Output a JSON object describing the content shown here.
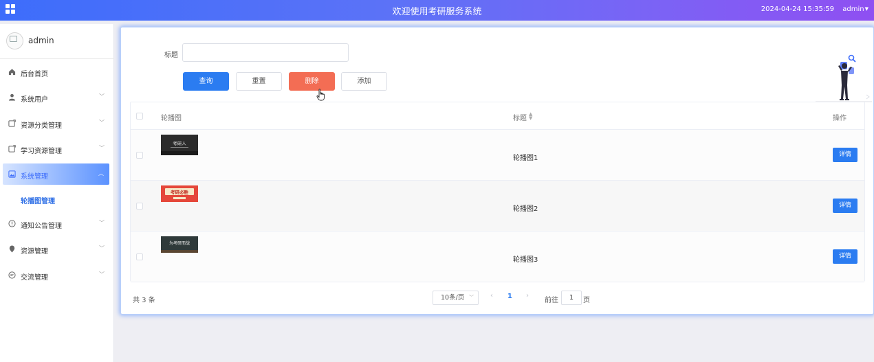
{
  "header": {
    "title": "欢迎使用考研服务系统",
    "datetime": "2024-04-24 15:35:59",
    "user": "admin",
    "apps_icon": "grid-icon"
  },
  "sidebar": {
    "username": "admin",
    "items": [
      {
        "label": "后台首页",
        "icon": "home-icon"
      },
      {
        "label": "系统用户",
        "icon": "user-icon",
        "has_arrow": true
      },
      {
        "label": "资源分类管理",
        "icon": "folder-icon",
        "has_arrow": true
      },
      {
        "label": "学习资源管理",
        "icon": "folder-icon",
        "has_arrow": true
      },
      {
        "label": "系统管理",
        "icon": "image-icon",
        "has_arrow": true,
        "active": true
      },
      {
        "label": "通知公告管理",
        "icon": "info-icon",
        "has_arrow": true
      },
      {
        "label": "资源管理",
        "icon": "location-icon",
        "has_arrow": true
      },
      {
        "label": "交流管理",
        "icon": "chat-icon",
        "has_arrow": true
      }
    ],
    "submenu_active": "轮播图管理"
  },
  "search": {
    "label": "标题",
    "value": "",
    "placeholder": ""
  },
  "actions": {
    "query": "查询",
    "reset": "重置",
    "delete": "删除",
    "add": "添加"
  },
  "table": {
    "columns": [
      "轮播图",
      "标题",
      "操作"
    ],
    "rows": [
      {
        "image_text": "考研人",
        "title": "轮播图1",
        "action": "详情"
      },
      {
        "image_text": "考研必胜",
        "title": "轮播图2",
        "action": "详情"
      },
      {
        "image_text": "为考研而战",
        "title": "轮播图3",
        "action": "详情"
      }
    ]
  },
  "pagination": {
    "total": "共 3 条",
    "page_size": "10条/页",
    "current_page": "1",
    "goto_label": "前往",
    "goto_value": "1",
    "goto_suffix": "页"
  },
  "colors": {
    "primary": "#2b7cf1",
    "danger": "#f36d54",
    "header_start": "#3d6dfb",
    "header_end": "#8f4ff2"
  }
}
